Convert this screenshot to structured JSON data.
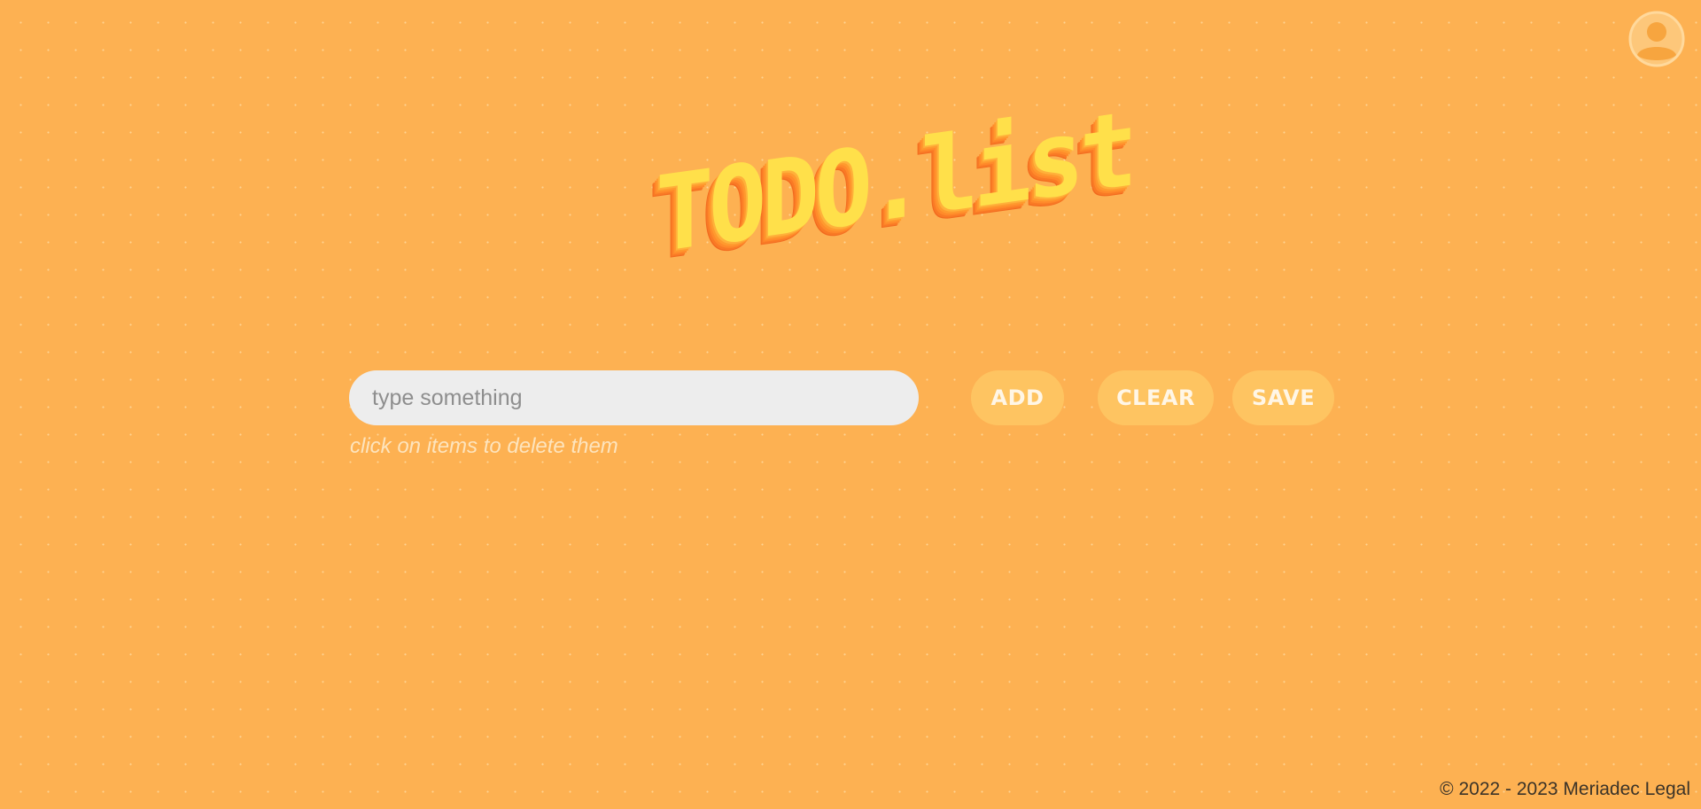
{
  "header": {
    "logo_text": "TODO.list",
    "avatar_icon": "user-avatar-icon"
  },
  "form": {
    "input_placeholder": "type something",
    "input_value": "",
    "add_label": "ADD",
    "clear_label": "CLEAR",
    "save_label": "SAVE",
    "hint": "click on items to delete them"
  },
  "footer": {
    "copyright": "© 2022 - 2023 Meriadec Legal"
  },
  "colors": {
    "background": "#fdb152",
    "button": "#fec461",
    "input": "#ededed",
    "logo_face": "#ffe04a",
    "logo_side": "#f26a1f"
  }
}
